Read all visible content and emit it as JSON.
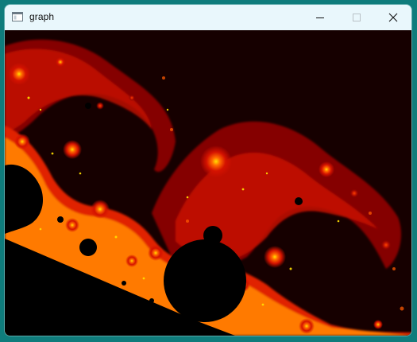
{
  "window": {
    "title": "graph",
    "icons": {
      "app": "window-app-icon",
      "minimize": "minimize-icon",
      "maximize": "maximize-icon",
      "close": "close-icon"
    }
  },
  "canvas": {
    "content": "fractal-render",
    "colors": {
      "background": "#100000",
      "deep_red": "#7a0000",
      "red": "#d41200",
      "orange": "#ff6a00",
      "yellow": "#ffe000",
      "interior": "#000000"
    }
  },
  "theme": {
    "desktop": "#0f7c7c",
    "titlebar": "#e9f7fc"
  }
}
